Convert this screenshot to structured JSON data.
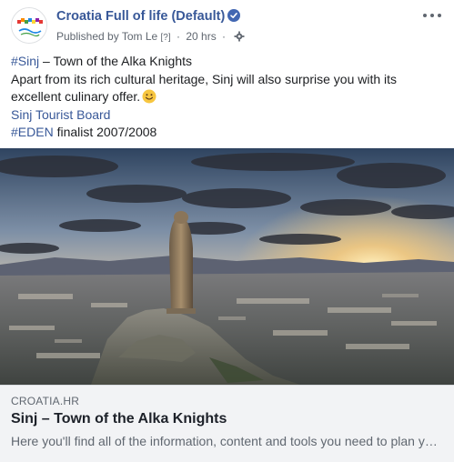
{
  "post": {
    "page_name": "Croatia Full of life (Default)",
    "published_by": "Published by Tom Le",
    "help_marker": "[?]",
    "separator": "·",
    "time": "20 hrs",
    "separator2": "·",
    "avatar_logo_text": "CROATIA",
    "avatar_tagline": "Full of life",
    "icons": {
      "verified": "verified-badge-icon",
      "privacy": "gear-icon",
      "more": "more-options-icon",
      "emoji": "smiley-emoji-icon"
    },
    "colors": {
      "link": "#385898",
      "meta": "#606770",
      "preview_bg": "#f2f3f5",
      "verified": "#4267b2"
    }
  },
  "text": {
    "hashtag_sinj": "#Sinj",
    "headline_rest": " – Town of the Alka Knights",
    "line2": "Apart from its rich cultural heritage, Sinj will also surprise you with its",
    "line3": "excellent culinary offer.",
    "board_link": "Sinj Tourist Board",
    "hashtag_eden": "#EDEN",
    "eden_rest": " finalist 2007/2008"
  },
  "preview": {
    "domain": "CROATIA.HR",
    "title": "Sinj – Town of the Alka Knights",
    "description": "Here you'll find all of the information, content and tools you need to plan your trip to Croatia."
  }
}
